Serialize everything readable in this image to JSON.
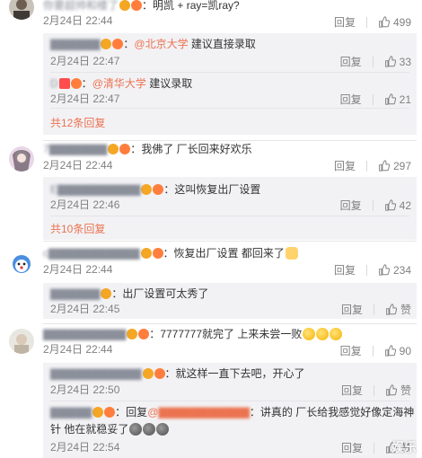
{
  "labels": {
    "reply": "回复",
    "like_word": "赞"
  },
  "c1": {
    "user": "你要超帅和楼了",
    "text": "明凯 + ray=凯ray?",
    "time": "2月24日 22:44",
    "likes": "499",
    "replies": [
      {
        "user": "",
        "mention": "@北京大学",
        "text": " 建议直接录取",
        "time": "2月24日 22:47",
        "likes": "33"
      },
      {
        "user": "D",
        "mention": "@清华大学",
        "text": " 建议录取",
        "time": "2月24日 22:47",
        "likes": "21"
      }
    ],
    "more": "共12条回复"
  },
  "c2": {
    "user": "7",
    "text": "我佛了 厂长回来好欢乐",
    "time": "2月24日 22:44",
    "likes": "297",
    "replies": [
      {
        "user": "E",
        "text": "这叫恢复出厂设置",
        "time": "2月24日 22:46",
        "likes": "42"
      }
    ],
    "more": "共10条回复"
  },
  "c3": {
    "user": "c",
    "text": "恢复出厂设置 都回来了",
    "time": "2月24日 22:44",
    "likes": "234",
    "replies": [
      {
        "user": "",
        "text": "出厂设置可太秀了",
        "time": "2月24日 22:45",
        "likes": "赞"
      }
    ]
  },
  "c4": {
    "user": "",
    "text": "7777777就完了 上来未尝一败",
    "time": "2月24日 22:44",
    "likes": "90",
    "replies": [
      {
        "user": "",
        "text": "就这样一直下去吧，开心了",
        "time": "2月24日 22:50",
        "likes": "赞"
      },
      {
        "user": "",
        "prefix": "回复",
        "mention": "@",
        "text": "讲真的 厂长给我感觉好像定海神",
        "text2": "针 他在就稳妥了",
        "time": "2月24日 22:54",
        "likes": "赞"
      }
    ]
  },
  "watermark": "娱乐"
}
